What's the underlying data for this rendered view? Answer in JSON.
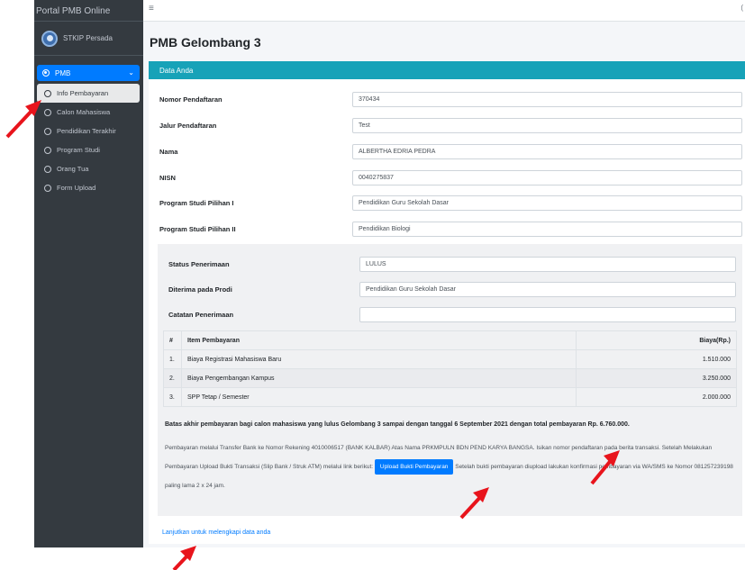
{
  "sidebar": {
    "brand": "Portal PMB Online",
    "user": "STKIP Persada",
    "menu_main": "PMB",
    "items": [
      {
        "label": "Info Pembayaran",
        "active": true
      },
      {
        "label": "Calon Mahasiswa",
        "active": false
      },
      {
        "label": "Pendidikan Terakhir",
        "active": false
      },
      {
        "label": "Program Studi",
        "active": false
      },
      {
        "label": "Orang Tua",
        "active": false
      },
      {
        "label": "Form Upload",
        "active": false
      }
    ]
  },
  "topbar": {
    "menu_icon": "hamburger-icon",
    "right_text": "("
  },
  "page": {
    "title": "PMB Gelombang 3"
  },
  "card": {
    "header": "Data Anda",
    "fields": [
      {
        "label": "Nomor Pendaftaran",
        "value": "370434"
      },
      {
        "label": "Jalur Pendaftaran",
        "value": "Test"
      },
      {
        "label": "Nama",
        "value": "ALBERTHA EDRIA PEDRA"
      },
      {
        "label": "NISN",
        "value": "0040275837"
      },
      {
        "label": "Program Studi Pilihan I",
        "value": "Pendidikan Guru Sekolah Dasar"
      },
      {
        "label": "Program Studi Pilihan II",
        "value": "Pendidikan Biologi"
      }
    ],
    "status": [
      {
        "label": "Status Penerimaan",
        "value": "LULUS"
      },
      {
        "label": "Diterima pada Prodi",
        "value": "Pendidikan Guru Sekolah Dasar"
      },
      {
        "label": "Catatan Penerimaan",
        "value": ""
      }
    ],
    "table": {
      "headers": [
        "#",
        "Item Pembayaran",
        "Biaya(Rp.)"
      ],
      "rows": [
        [
          "1.",
          "Biaya Registrasi Mahasiswa Baru",
          "1.510.000"
        ],
        [
          "2.",
          "Biaya Pengembangan Kampus",
          "3.250.000"
        ],
        [
          "3.",
          "SPP Tetap / Semester",
          "2.000.000"
        ]
      ]
    },
    "deadline": "Batas akhir pembayaran bagi calon mahasiswa yang lulus Gelombang 3 sampai dengan tanggal 6 September 2021 dengan total pembayaran Rp. 6.760.000.",
    "note_part1": "Pembayaran melalui Transfer Bank ke Nomor Rekening 4010006517 (BANK KALBAR) Atas Nama PRKMPULN BDN PEND KARYA BANGSA. Isikan nomor pendaftaran pada berita transaksi. Setelah Melakukan Pembayaran Upload Bukti Transaksi (Slip Bank / Struk ATM) melalui link berikut:",
    "upload_button": "Upload Bukti Pembayaran",
    "note_part2": "Setelah bukti pembayaran diupload lakukan konfirmasi pembayaran via WA/SMS ke Nomor 081257239198 paling lama 2 x 24 jam."
  },
  "footer_link": "Lanjutkan untuk melengkapi data anda",
  "colors": {
    "sidebar": "#343a40",
    "primary": "#007bff",
    "card_header": "#17a2b8",
    "arrow": "#e8141c"
  }
}
